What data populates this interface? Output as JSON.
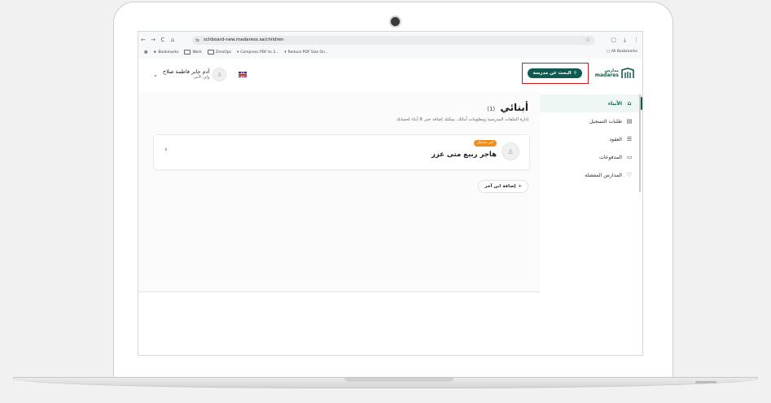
{
  "browser": {
    "url": "schboard-new.madaress.sa/children",
    "nav_back": "←",
    "nav_forward": "→",
    "nav_reload": "C",
    "nav_home": "⌂",
    "bookmarks": [
      {
        "label": "Bookmarks"
      },
      {
        "label": "Work"
      },
      {
        "label": "ZeroOps"
      },
      {
        "label": "Compress PDF to 3..."
      },
      {
        "label": "Reduce PDF Size On..."
      }
    ],
    "all_bookmarks": "All Bookmarks"
  },
  "header": {
    "logo_ar": "مدارس",
    "logo_en": "madares",
    "search_label": "البحث عن مدرسة",
    "user_name": "آدم جابر فاطمة صلاح",
    "user_role": "ولي الأمر",
    "language": "English"
  },
  "sidebar": {
    "items": [
      {
        "label": "الأبناء",
        "icon": "graduation-cap-icon",
        "glyph": "🎓",
        "active": true
      },
      {
        "label": "طلبات التسجيل",
        "icon": "document-icon",
        "glyph": "📄",
        "active": false
      },
      {
        "label": "العقود",
        "icon": "list-icon",
        "glyph": "☰",
        "active": false
      },
      {
        "label": "المدفوعات",
        "icon": "wallet-icon",
        "glyph": "▭",
        "active": false
      },
      {
        "label": "المدارس المفضلة",
        "icon": "heart-icon",
        "glyph": "♡",
        "active": false
      }
    ]
  },
  "main": {
    "title": "أبنائي",
    "count": "(1)",
    "subtitle": "إدارة الملفات المدرسية ومعلومات أبنائك. يمكنك إضافة حتى 8 أبناء لحسابك",
    "children": [
      {
        "name": "هاجر ربيع متى عزز",
        "badge": "غير مسجل"
      }
    ],
    "add_child_label": "إضافة ابن آخر"
  },
  "colors": {
    "primary": "#0f5b52",
    "badge": "#f28c1e",
    "highlight": "#d7191c"
  }
}
